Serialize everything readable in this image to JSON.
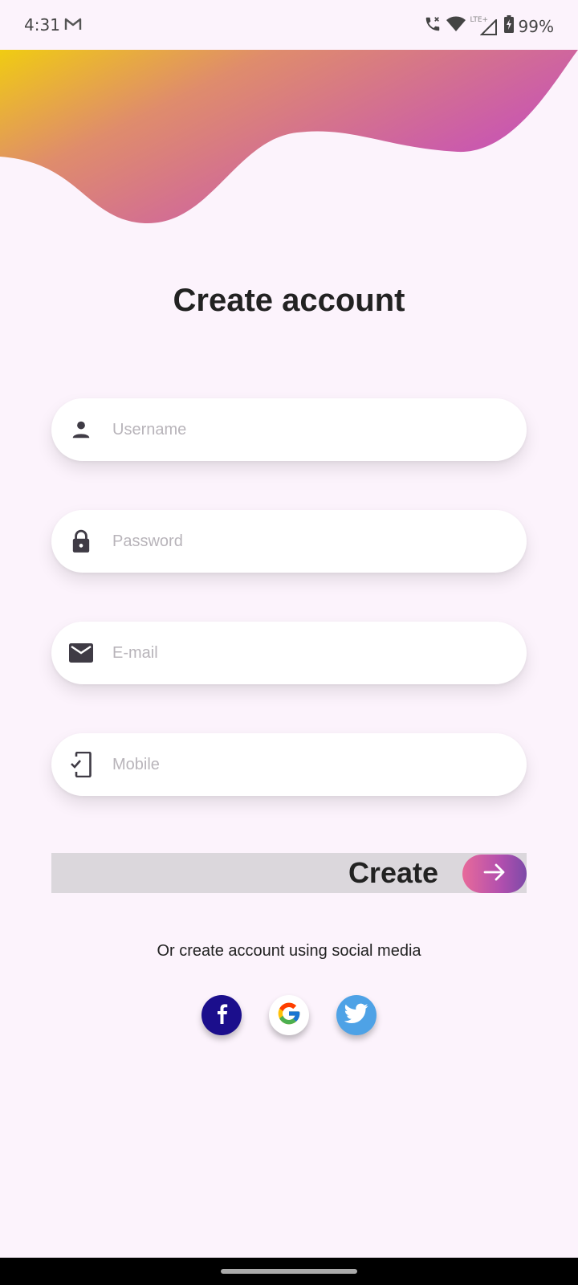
{
  "status_bar": {
    "time": "4:31",
    "battery": "99%",
    "icons": [
      "gmail-icon",
      "call-wifi-icon",
      "wifi-icon",
      "lte-signal-icon",
      "battery-icon"
    ]
  },
  "colors": {
    "background": "#fcf3fc",
    "wave_start": "#f0cc12",
    "wave_end": "#c44bc0",
    "button_gradient_start": "#e86a9a",
    "button_gradient_end": "#7d4aa8",
    "facebook": "#1b0e8c",
    "twitter": "#4ea2e6"
  },
  "form": {
    "title": "Create account",
    "fields": [
      {
        "icon": "person-icon",
        "placeholder": "Username"
      },
      {
        "icon": "lock-icon",
        "placeholder": "Password"
      },
      {
        "icon": "mail-icon",
        "placeholder": "E-mail"
      },
      {
        "icon": "phone-check-icon",
        "placeholder": "Mobile"
      }
    ],
    "create_label": "Create"
  },
  "social": {
    "text": "Or create account using social media",
    "providers": [
      "Facebook",
      "Google",
      "Twitter"
    ]
  }
}
